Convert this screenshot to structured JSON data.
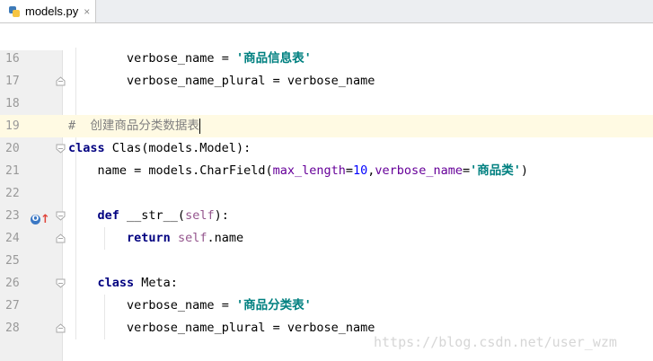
{
  "tab": {
    "filename": "models.py",
    "close_glyph": "×"
  },
  "watermark": "https://blog.csdn.net/user_wzm",
  "lines": [
    {
      "no": "16",
      "indent": "        ",
      "parts": [
        {
          "t": "verbose_name = ",
          "c": ""
        },
        {
          "t": "'商品信息表'",
          "c": "str"
        }
      ]
    },
    {
      "no": "17",
      "indent": "        ",
      "parts": [
        {
          "t": "verbose_name_plural = verbose_name",
          "c": ""
        }
      ]
    },
    {
      "no": "18",
      "indent": "",
      "parts": []
    },
    {
      "no": "19",
      "indent": "",
      "current": true,
      "parts": [
        {
          "t": "#  创建商品分类数据表",
          "c": "cmt"
        }
      ]
    },
    {
      "no": "20",
      "indent": "",
      "parts": [
        {
          "t": "class",
          "c": "kw"
        },
        {
          "t": " Clas(models.Model):",
          "c": ""
        }
      ]
    },
    {
      "no": "21",
      "indent": "    ",
      "parts": [
        {
          "t": "name = models.CharField(",
          "c": ""
        },
        {
          "t": "max_length",
          "c": "param"
        },
        {
          "t": "=",
          "c": ""
        },
        {
          "t": "10",
          "c": "num"
        },
        {
          "t": ",",
          "c": ""
        },
        {
          "t": "verbose_name",
          "c": "param"
        },
        {
          "t": "=",
          "c": ""
        },
        {
          "t": "'商品类'",
          "c": "str"
        },
        {
          "t": ")",
          "c": ""
        }
      ]
    },
    {
      "no": "22",
      "indent": "",
      "parts": []
    },
    {
      "no": "23",
      "indent": "    ",
      "parts": [
        {
          "t": "def",
          "c": "kw"
        },
        {
          "t": " __str__(",
          "c": ""
        },
        {
          "t": "self",
          "c": "self"
        },
        {
          "t": "):",
          "c": ""
        }
      ]
    },
    {
      "no": "24",
      "indent": "        ",
      "parts": [
        {
          "t": "return",
          "c": "kw"
        },
        {
          "t": " ",
          "c": ""
        },
        {
          "t": "self",
          "c": "self"
        },
        {
          "t": ".name",
          "c": ""
        }
      ]
    },
    {
      "no": "25",
      "indent": "",
      "parts": []
    },
    {
      "no": "26",
      "indent": "    ",
      "parts": [
        {
          "t": "class",
          "c": "kw"
        },
        {
          "t": " Meta:",
          "c": ""
        }
      ]
    },
    {
      "no": "27",
      "indent": "        ",
      "parts": [
        {
          "t": "verbose_name = ",
          "c": ""
        },
        {
          "t": "'商品分类表'",
          "c": "str"
        }
      ]
    },
    {
      "no": "28",
      "indent": "        ",
      "parts": [
        {
          "t": "verbose_name_plural = verbose_name",
          "c": ""
        }
      ]
    }
  ],
  "override_marker": {
    "line": "23",
    "glyph": "O",
    "arrow": "↑",
    "color": "#3b78c4",
    "arrow_color": "#e0443a"
  },
  "colors": {
    "keyword": "#000080",
    "string": "#008080",
    "comment": "#808080",
    "current_line": "#fffae3"
  }
}
